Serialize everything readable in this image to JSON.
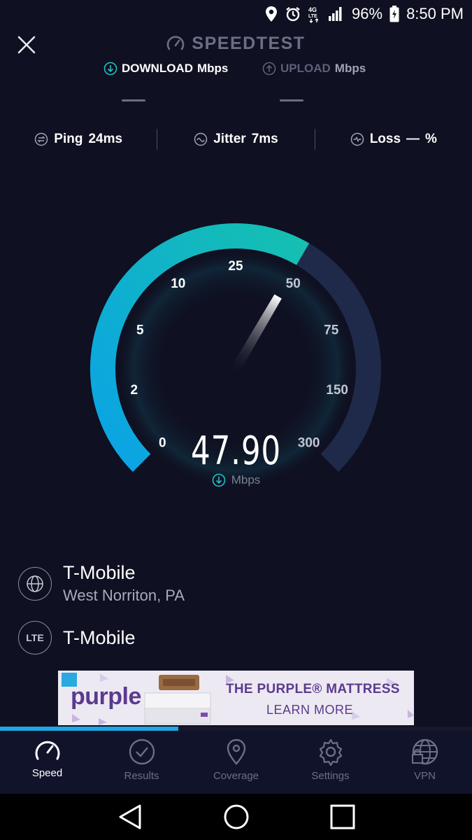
{
  "status_bar": {
    "network": "4G LTE",
    "battery": "96%",
    "time": "8:50 PM"
  },
  "header": {
    "title": "SPEEDTEST",
    "download_label": "DOWNLOAD",
    "download_unit": "Mbps",
    "upload_label": "UPLOAD",
    "upload_unit": "Mbps"
  },
  "metrics": {
    "ping_label": "Ping",
    "ping_value": "24ms",
    "jitter_label": "Jitter",
    "jitter_value": "7ms",
    "loss_label": "Loss",
    "loss_value": "—",
    "loss_unit": "%"
  },
  "gauge": {
    "ticks": [
      "0",
      "2",
      "5",
      "10",
      "25",
      "50",
      "75",
      "150",
      "300"
    ],
    "current_value": 47.9,
    "needle_tick_position": 4.9
  },
  "speed": {
    "value": "47.90",
    "unit": "Mbps"
  },
  "provider": {
    "isp_name": "T-Mobile",
    "isp_location": "West Norriton, PA",
    "server_badge": "LTE",
    "server_name": "T-Mobile"
  },
  "ad": {
    "brand": "purple",
    "headline": "THE PURPLE® MATTRESS",
    "cta": "LEARN MORE"
  },
  "progress": {
    "fraction": 0.378
  },
  "tabs": [
    {
      "label": "Speed",
      "icon": "speedometer-icon",
      "active": true
    },
    {
      "label": "Results",
      "icon": "check-circle-icon",
      "active": false
    },
    {
      "label": "Coverage",
      "icon": "location-pin-icon",
      "active": false
    },
    {
      "label": "Settings",
      "icon": "gear-icon",
      "active": false
    },
    {
      "label": "VPN",
      "icon": "globe-lock-icon",
      "active": false
    }
  ],
  "colors": {
    "background": "#0f1021",
    "arc_start": "#0aa3e6",
    "arc_end": "#15c0b0",
    "arc_inactive": "#1f2a4a",
    "accent_teal": "#1fc2c2"
  }
}
